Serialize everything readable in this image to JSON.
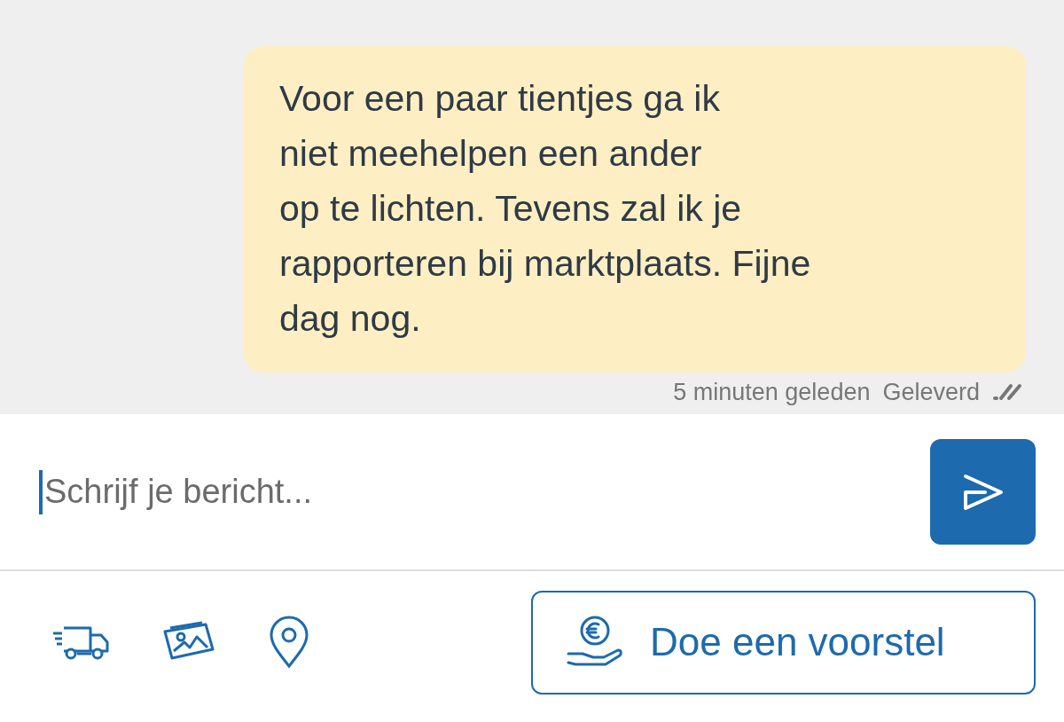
{
  "message": {
    "text": "Voor een paar tientjes ga ik\nniet meehelpen een ander\nop te lichten. Tevens zal ik je\nrapporteren bij marktplaats. Fijne\ndag nog.",
    "time": "5 minuten geleden",
    "status": "Geleverd",
    "delivered": true
  },
  "composer": {
    "placeholder": "Schrijf je bericht..."
  },
  "actions": {
    "offer_button": "Doe een voorstel"
  }
}
